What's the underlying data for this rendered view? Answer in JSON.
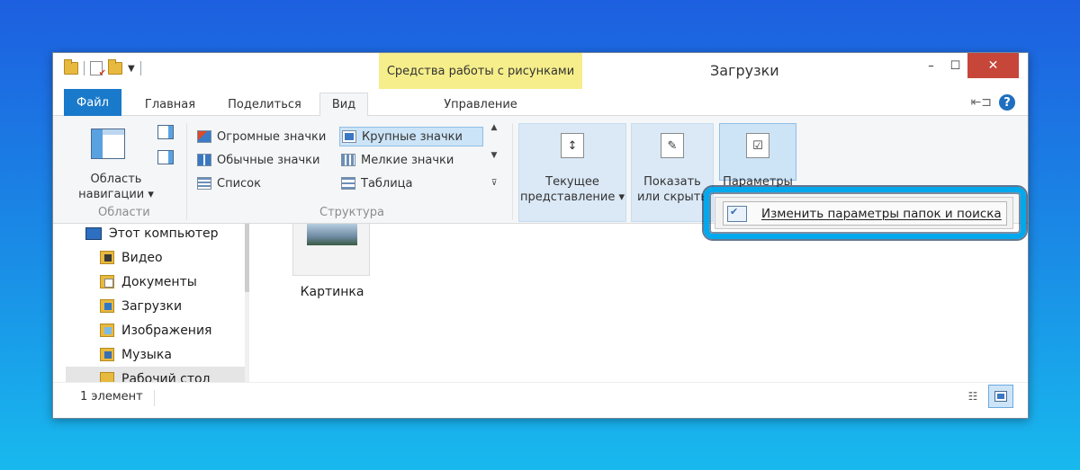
{
  "window": {
    "title": "Загрузки",
    "contextual_tab_header": "Средства работы с рисунками",
    "controls": {
      "minimize": "–",
      "maximize": "☐",
      "close": "✕"
    }
  },
  "tabs": {
    "file": "Файл",
    "home": "Главная",
    "share": "Поделиться",
    "view": "Вид",
    "manage": "Управление",
    "help": "?"
  },
  "ribbon": {
    "panes_group": {
      "label": "Области",
      "nav_pane_button": "Область навигации ▾"
    },
    "layout_group": {
      "label": "Структура",
      "items": [
        {
          "label": "Огромные значки",
          "icon": "huge-icons-icon"
        },
        {
          "label": "Крупные значки",
          "icon": "large-icons-icon",
          "selected": true
        },
        {
          "label": "Обычные значки",
          "icon": "medium-icons-icon"
        },
        {
          "label": "Мелкие значки",
          "icon": "small-icons-icon"
        },
        {
          "label": "Список",
          "icon": "list-icon"
        },
        {
          "label": "Таблица",
          "icon": "details-icon"
        }
      ]
    },
    "current_view": "Текущее представление ▾",
    "show_hide": "Показать или скрыть",
    "options": "Параметры"
  },
  "options_menu": {
    "item": "Изменить параметры папок и поиска"
  },
  "nav_tree": {
    "items": [
      {
        "label": "Этот компьютер",
        "icon": "computer-icon"
      },
      {
        "label": "Видео",
        "icon": "videos-folder-icon"
      },
      {
        "label": "Документы",
        "icon": "documents-folder-icon"
      },
      {
        "label": "Загрузки",
        "icon": "downloads-folder-icon"
      },
      {
        "label": "Изображения",
        "icon": "pictures-folder-icon"
      },
      {
        "label": "Музыка",
        "icon": "music-folder-icon"
      },
      {
        "label": "Рабочий стол",
        "icon": "desktop-folder-icon"
      }
    ]
  },
  "files": [
    {
      "name": "Картинка",
      "icon": "image-thumbnail"
    }
  ],
  "status": {
    "count": "1 элемент"
  },
  "colors": {
    "file_tab": "#1979ca",
    "contextual_header": "#f6ee8a",
    "highlight_frame": "#00a8ee",
    "close_button": "#c7463a"
  }
}
